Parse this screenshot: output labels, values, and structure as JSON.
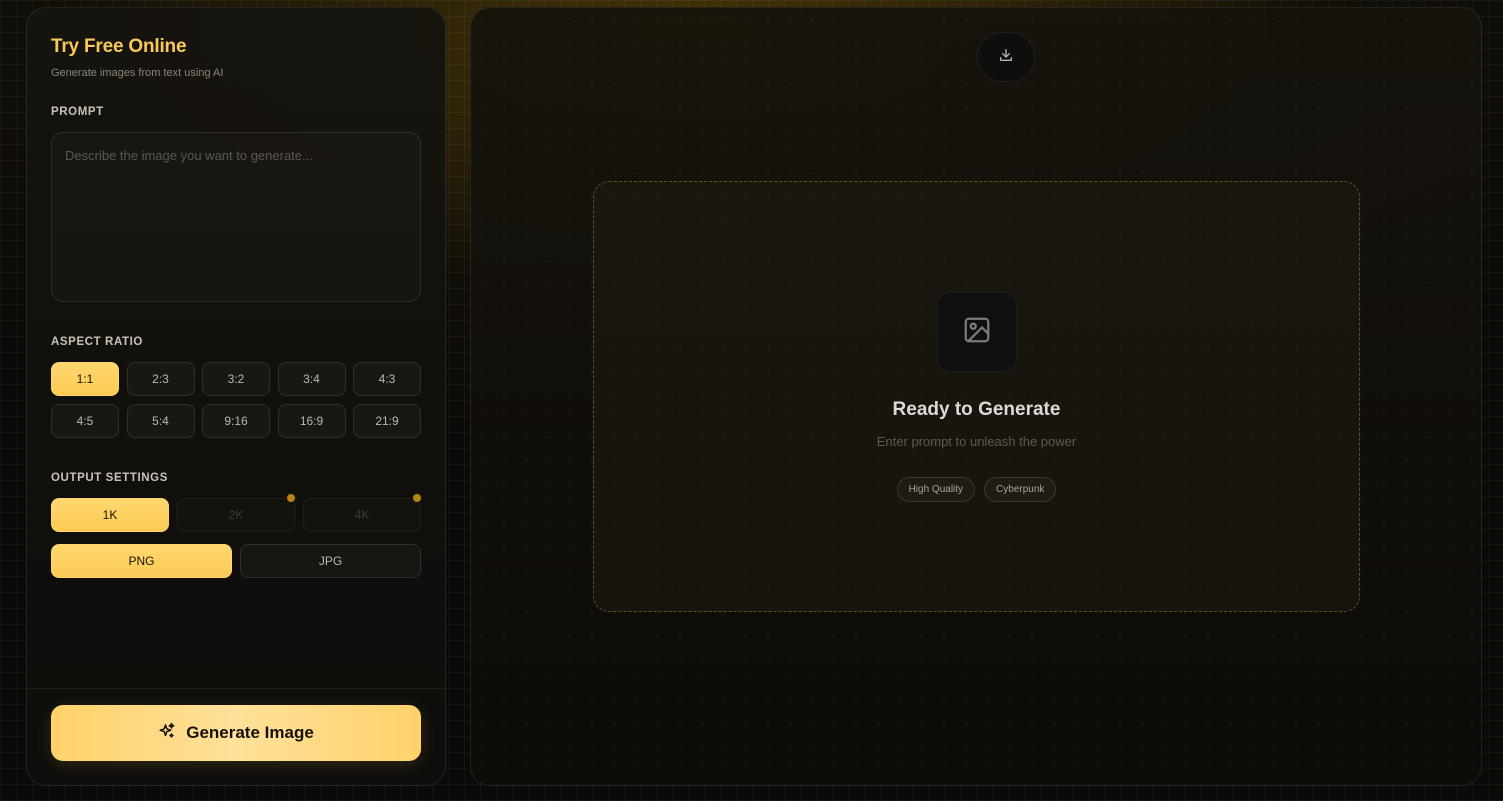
{
  "left_panel": {
    "title": "Try Free Online",
    "subtitle": "Generate images from text using AI",
    "prompt": {
      "label": "PROMPT",
      "placeholder": "Describe the image you want to generate...",
      "value": ""
    },
    "aspect_ratio": {
      "label": "ASPECT RATIO",
      "selected": "1:1",
      "options": [
        "1:1",
        "2:3",
        "3:2",
        "3:4",
        "4:3",
        "4:5",
        "5:4",
        "9:16",
        "16:9",
        "21:9"
      ]
    },
    "output_settings": {
      "label": "OUTPUT SETTINGS",
      "resolution": {
        "selected": "1K",
        "options": [
          {
            "label": "1K",
            "locked": false
          },
          {
            "label": "2K",
            "locked": true
          },
          {
            "label": "4K",
            "locked": true
          }
        ]
      },
      "format": {
        "selected": "PNG",
        "options": [
          "PNG",
          "JPG"
        ]
      }
    },
    "generate_button": {
      "label": "Generate Image",
      "icon": "sparkles-icon"
    }
  },
  "right_panel": {
    "download_icon": "download-icon",
    "empty_state": {
      "icon": "image-icon",
      "title": "Ready to Generate",
      "subtitle": "Enter prompt to unleash the power",
      "tags": [
        "High Quality",
        "Cyberpunk"
      ]
    }
  },
  "colors": {
    "accent": "#ffd26a",
    "accent_title": "#f7c85a",
    "premium_dot": "#b58416",
    "background": "#0b0a08"
  }
}
